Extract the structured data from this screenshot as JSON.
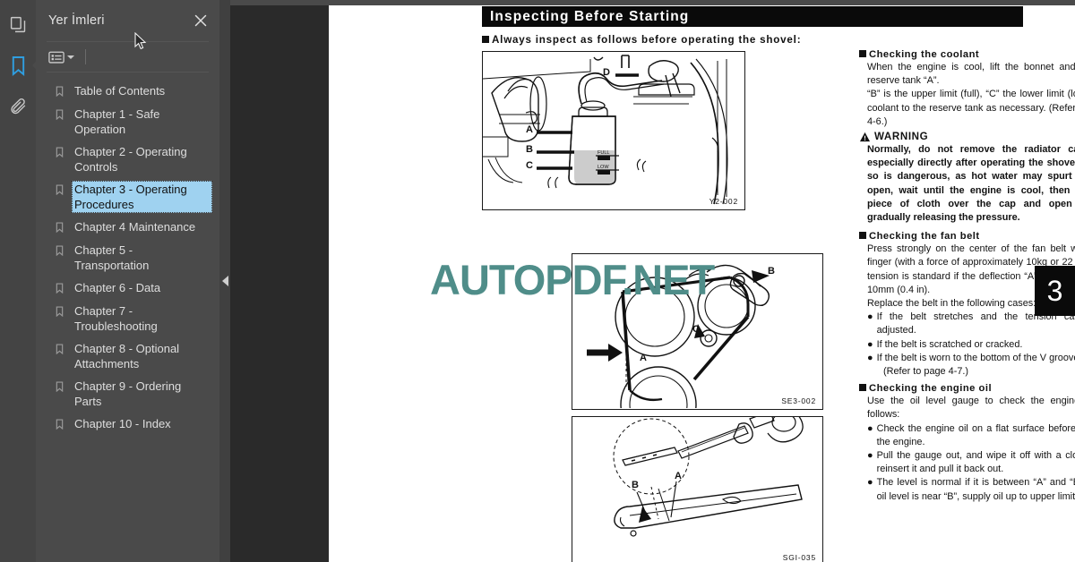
{
  "rail": {
    "items": [
      {
        "name": "pages-icon",
        "label": "Pages"
      },
      {
        "name": "bookmark-icon",
        "label": "Bookmarks"
      },
      {
        "name": "attachment-icon",
        "label": "Attachments"
      }
    ]
  },
  "panel": {
    "title": "Yer İmleri",
    "close_label": "✕",
    "toolbar": {
      "options_icon": "list-options-icon",
      "caret": "chevron-down-icon"
    },
    "bookmarks": [
      {
        "label": "Table of Contents",
        "selected": false
      },
      {
        "label": "Chapter 1 - Safe Operation",
        "selected": false
      },
      {
        "label": "Chapter 2 - Operating Controls",
        "selected": false
      },
      {
        "label": "Chapter 3 - Operating Procedures",
        "selected": true
      },
      {
        "label": "Chapter 4 Maintenance",
        "selected": false
      },
      {
        "label": "Chapter 5 - Transportation",
        "selected": false
      },
      {
        "label": "Chapter 6 - Data",
        "selected": false
      },
      {
        "label": "Chapter 7 - Troubleshooting",
        "selected": false
      },
      {
        "label": "Chapter 8 - Optional Attachments",
        "selected": false
      },
      {
        "label": "Chapter 9 - Ordering Parts",
        "selected": false
      },
      {
        "label": "Chapter 10 - Index",
        "selected": false
      }
    ]
  },
  "document": {
    "banner_title": "Inspecting Before Starting",
    "intro": "Always inspect as follows before operating the shovel:",
    "chapter_tab": "3",
    "watermark": "AUTOPDF.NET",
    "watermark_color": "#4f8d89",
    "figures": [
      {
        "code": "Y2-002",
        "letters": [
          "A",
          "B",
          "C",
          "D"
        ],
        "caption": "engine-bay-reserve-tank-figure"
      },
      {
        "code": "SE3-002",
        "letters": [
          "A",
          "B",
          "C"
        ],
        "caption": "fan-belt-pulley-figure"
      },
      {
        "code": "SGI-035",
        "letters": [
          "A",
          "B"
        ],
        "caption": "oil-level-gauge-figure"
      }
    ],
    "sections": {
      "coolant": {
        "heading": "Checking the coolant",
        "paragraphs": [
          "When the engine is cool, lift the bonnet and inspect reserve tank “A”.",
          "“B” is the upper limit (full), “C” the lower limit (low). Add coolant to the reserve tank as necessary. (Refer to page 4-6.)"
        ],
        "warning_label": "WARNING",
        "warning_text": "Normally, do not remove the radiator cap “D”, especially directly after operating the shovel. Doing so is dangerous, as hot water may spurt out. To open, wait until the engine is cool, then place a piece of cloth over the cap and open slowly, gradually releasing the pressure."
      },
      "fan_belt": {
        "heading": "Checking the fan belt",
        "paragraphs": [
          "Press strongly on the center of the fan belt with your finger (with a force of approximately 10kg or 22 lb.). The tension is standard if the deflection “A” is approximately 10mm (0.4 in).",
          "Replace the belt in the following cases:"
        ],
        "bullets": [
          "If the belt stretches and the tension cannot be adjusted.",
          "If the belt is scratched or cracked.",
          "If the belt is worn to the bottom of the V groove."
        ],
        "continuation": "(Refer to page 4-7.)"
      },
      "engine_oil": {
        "heading": "Checking the engine oil",
        "paragraphs": [
          "Use the oil level gauge to check the engine oil as follows:"
        ],
        "bullets": [
          "Check the engine oil on a flat surface before starting the engine.",
          "Pull the gauge out, and wipe it off with a cloth, then reinsert it and pull it back out.",
          "The level is normal if it is between “A” and “B”. If the oil level is near “B”, supply oil up to upper limit"
        ]
      }
    }
  }
}
